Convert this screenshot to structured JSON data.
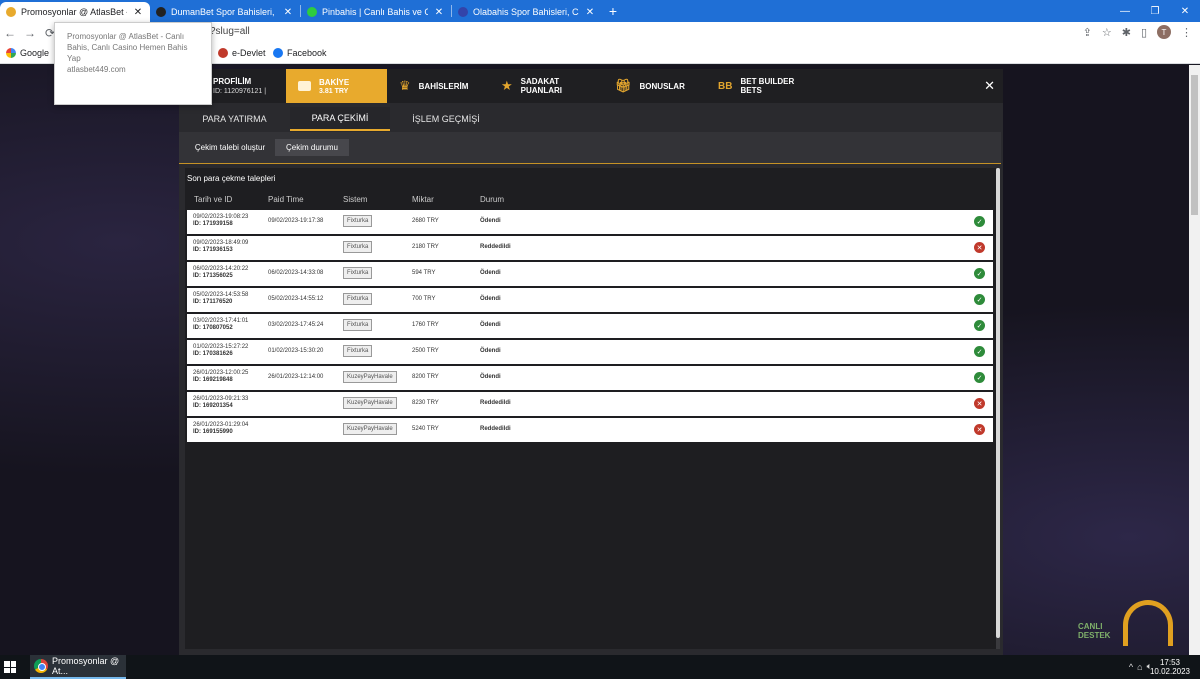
{
  "browser": {
    "tabs": [
      {
        "title": "Promosyonlar @ AtlasBet - Canlı",
        "color": "#e8aa2d",
        "active": true
      },
      {
        "title": "DumanBet Spor Bahisleri, Canlı B",
        "color": "#222222",
        "active": false
      },
      {
        "title": "Pinbahis | Canlı Bahis ve Canlı Ca",
        "color": "#2ecc40",
        "active": false
      },
      {
        "title": "Olabahis Spor Bahisleri, Canlı Bal",
        "color": "#3344aa",
        "active": false
      }
    ],
    "url_fragment": "?slug=all",
    "avatar_letter": "T",
    "bookmarks": {
      "google": "Google",
      "edevlet": "e-Devlet",
      "facebook": "Facebook"
    },
    "tooltip": {
      "title": "Promosyonlar @ AtlasBet - Canlı Bahis, Canlı Casino Hemen Bahis Yap",
      "host": "atlasbet449.com"
    }
  },
  "modal": {
    "profile_label": "PROFİLİM",
    "profile_id": "ID: 1120976121 |",
    "balance_label": "BAKİYE",
    "balance_value": "3.81 TRY",
    "bets_label": "BAHİSLERİM",
    "loyalty_label": "SADAKAT PUANLARI",
    "bonus_label": "BONUSLAR",
    "builder_label": "BET BUILDER BETS",
    "close": "✕",
    "subtabs": {
      "deposit": "PARA YATIRMA",
      "withdraw": "PARA ÇEKİMİ",
      "history": "İŞLEM GEÇMİŞİ"
    },
    "panel_tabs": {
      "create": "Çekim talebi oluştur",
      "status": "Çekim durumu"
    },
    "section_title": "Son para çekme talepleri",
    "columns": {
      "date": "Tarih ve ID",
      "paid": "Paid Time",
      "system": "Sistem",
      "amount": "Miktar",
      "status": "Durum"
    }
  },
  "withdrawals": [
    {
      "date": "09/02/2023-19:08:23",
      "id": "ID: 171939158",
      "paid": "09/02/2023-19:17:38",
      "system": "Fixturka",
      "amount": "2680 TRY",
      "status": "Ödendi",
      "ok": true
    },
    {
      "date": "09/02/2023-18:49:09",
      "id": "ID: 171936153",
      "paid": "",
      "system": "Fixturka",
      "amount": "2180 TRY",
      "status": "Reddedildi",
      "ok": false
    },
    {
      "date": "06/02/2023-14:20:22",
      "id": "ID: 171356025",
      "paid": "06/02/2023-14:33:08",
      "system": "Fixturka",
      "amount": "594 TRY",
      "status": "Ödendi",
      "ok": true
    },
    {
      "date": "05/02/2023-14:53:58",
      "id": "ID: 171176520",
      "paid": "05/02/2023-14:55:12",
      "system": "Fixturka",
      "amount": "700 TRY",
      "status": "Ödendi",
      "ok": true
    },
    {
      "date": "03/02/2023-17:41:01",
      "id": "ID: 170807052",
      "paid": "03/02/2023-17:45:24",
      "system": "Fixturka",
      "amount": "1760 TRY",
      "status": "Ödendi",
      "ok": true
    },
    {
      "date": "01/02/2023-15:27:22",
      "id": "ID: 170381626",
      "paid": "01/02/2023-15:30:20",
      "system": "Fixturka",
      "amount": "2500 TRY",
      "status": "Ödendi",
      "ok": true
    },
    {
      "date": "26/01/2023-12:00:25",
      "id": "ID: 169219848",
      "paid": "26/01/2023-12:14:00",
      "system": "KuzeyPayHavale",
      "amount": "8200 TRY",
      "status": "Ödendi",
      "ok": true
    },
    {
      "date": "26/01/2023-09:21:33",
      "id": "ID: 169201354",
      "paid": "",
      "system": "KuzeyPayHavale",
      "amount": "8230 TRY",
      "status": "Reddedildi",
      "ok": false
    },
    {
      "date": "26/01/2023-01:29:04",
      "id": "ID: 169155990",
      "paid": "",
      "system": "KuzeyPayHavale",
      "amount": "5240 TRY",
      "status": "Reddedildi",
      "ok": false
    }
  ],
  "live_support": {
    "line1": "CANLI",
    "line2": "DESTEK"
  },
  "taskbar": {
    "app_title": "Promosyonlar @ At...",
    "time": "17:53",
    "date": "10.02.2023"
  }
}
